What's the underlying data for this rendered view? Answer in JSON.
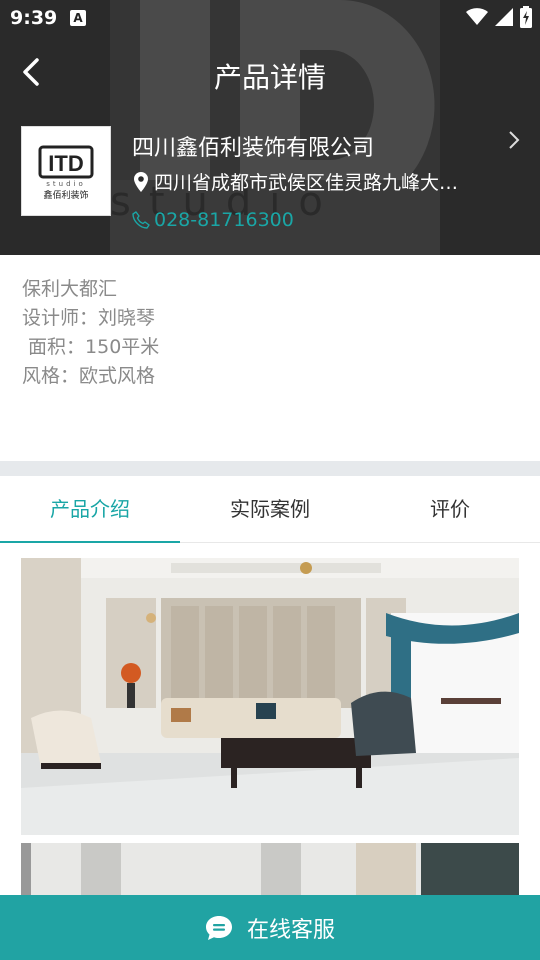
{
  "status_bar": {
    "time": "9:39",
    "notification_icon": "A"
  },
  "nav": {
    "title": "产品详情"
  },
  "company": {
    "logo_text": "ITD",
    "logo_sub": "studio",
    "logo_cn": "鑫佰利装饰",
    "name": "四川鑫佰利装饰有限公司",
    "address": "四川省成都市武侯区佳灵路九峰大…",
    "phone": "028-81716300"
  },
  "product_info": {
    "lines": [
      "保利大都汇",
      "设计师：刘晓琴",
      " 面积：150平米",
      "风格：欧式风格"
    ]
  },
  "tabs": [
    {
      "label": "产品介绍",
      "active": true
    },
    {
      "label": "实际案例",
      "active": false
    },
    {
      "label": "评价",
      "active": false
    }
  ],
  "bottom_bar": {
    "label": "在线客服"
  },
  "colors": {
    "accent": "#21a3a3",
    "header_bg": "#2b2b2b",
    "divider": "#e6e9ec"
  },
  "icons": [
    "back-arrow-icon",
    "location-pin-icon",
    "phone-icon",
    "chevron-right-icon",
    "chat-icon",
    "wifi-icon",
    "signal-icon",
    "battery-icon"
  ]
}
